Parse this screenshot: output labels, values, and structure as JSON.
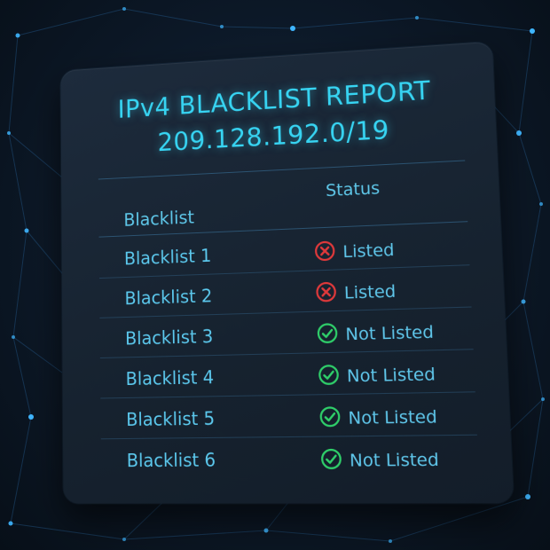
{
  "report": {
    "title_line1": "IPv4 BLACKLIST REPORT",
    "title_line2": "209.128.192.0/19"
  },
  "table": {
    "col_blacklist": "Blacklist",
    "col_status": "Status",
    "rows": [
      {
        "name": "Blacklist 1",
        "status": "Listed",
        "state": "listed"
      },
      {
        "name": "Blacklist 2",
        "status": "Listed",
        "state": "listed"
      },
      {
        "name": "Blacklist 3",
        "status": "Not Listed",
        "state": "clear"
      },
      {
        "name": "Blacklist 4",
        "status": "Not Listed",
        "state": "clear"
      },
      {
        "name": "Blacklist 5",
        "status": "Not Listed",
        "state": "clear"
      },
      {
        "name": "Blacklist 6",
        "status": "Not Listed",
        "state": "clear"
      }
    ]
  },
  "colors": {
    "accent": "#37d4f2",
    "listed": "#e0393b",
    "not_listed": "#2fcf6a",
    "panel": "#1a2736"
  },
  "icons": {
    "listed": "x-circle-icon",
    "not_listed": "check-circle-icon"
  }
}
